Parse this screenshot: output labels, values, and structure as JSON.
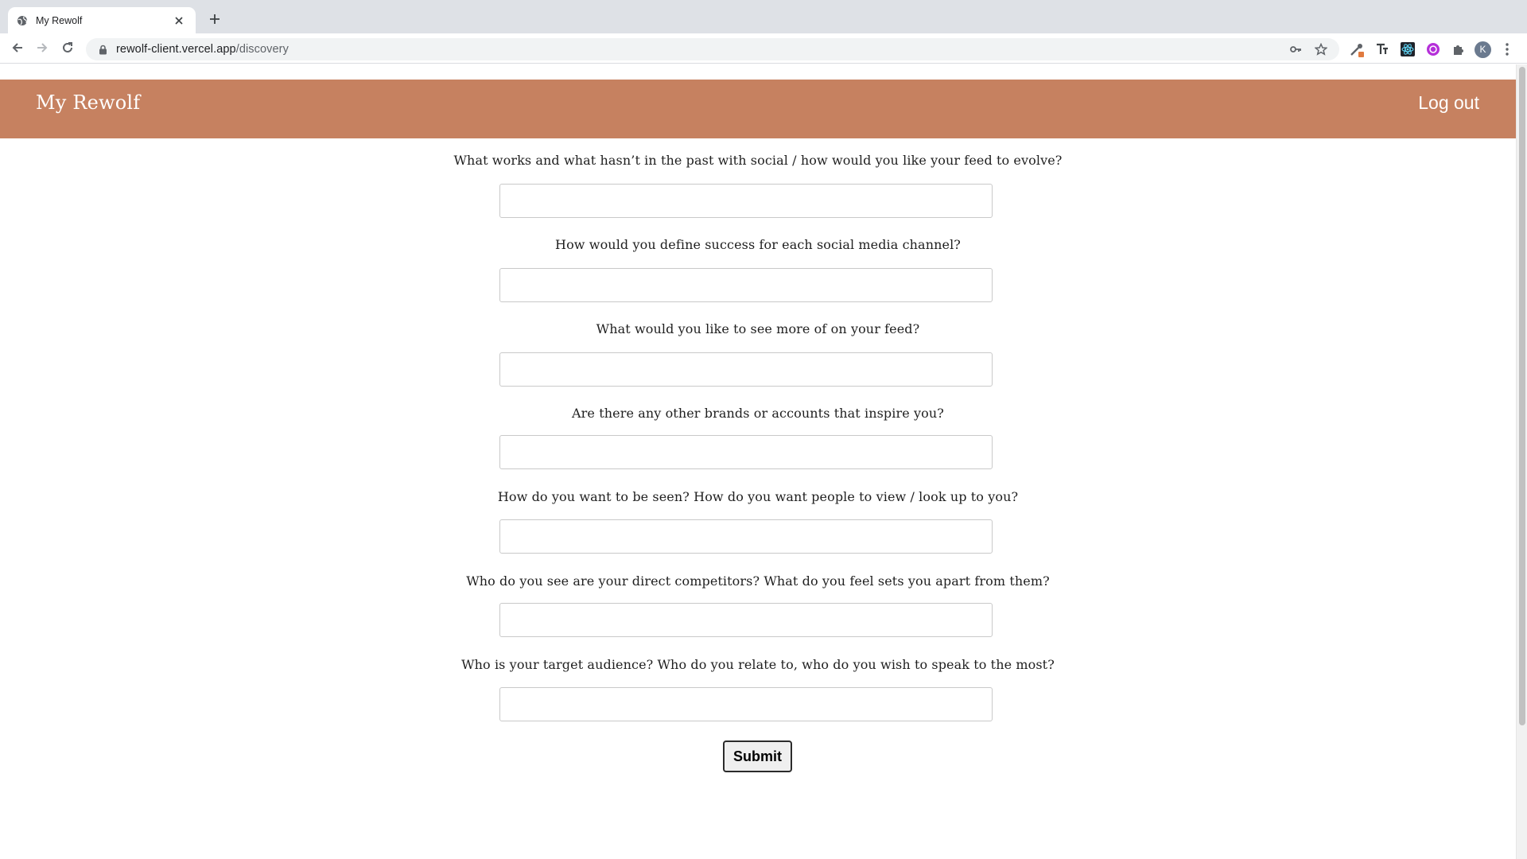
{
  "browser": {
    "tab_title": "My Rewolf",
    "url_host": "rewolf-client.vercel.app",
    "url_path": "/discovery",
    "avatar_initial": "K"
  },
  "header": {
    "brand": "My Rewolf",
    "logout_label": "Log out",
    "color": "#c68160"
  },
  "form": {
    "questions": [
      {
        "label": "What works and what hasn’t in the past with social / how would you like your feed to evolve?",
        "value": ""
      },
      {
        "label": "How would you define success for each social media channel?",
        "value": ""
      },
      {
        "label": "What would you like to see more of on your feed?",
        "value": ""
      },
      {
        "label": "Are there any other brands or accounts that inspire you?",
        "value": ""
      },
      {
        "label": "How do you want to be seen? How do you want people to view / look up to you?",
        "value": ""
      },
      {
        "label": "Who do you see are your direct competitors? What do you feel sets you apart from them?",
        "value": ""
      },
      {
        "label": "Who is your target audience? Who do you relate to, who do you wish to speak to the most?",
        "value": ""
      }
    ],
    "submit_label": "Submit"
  }
}
